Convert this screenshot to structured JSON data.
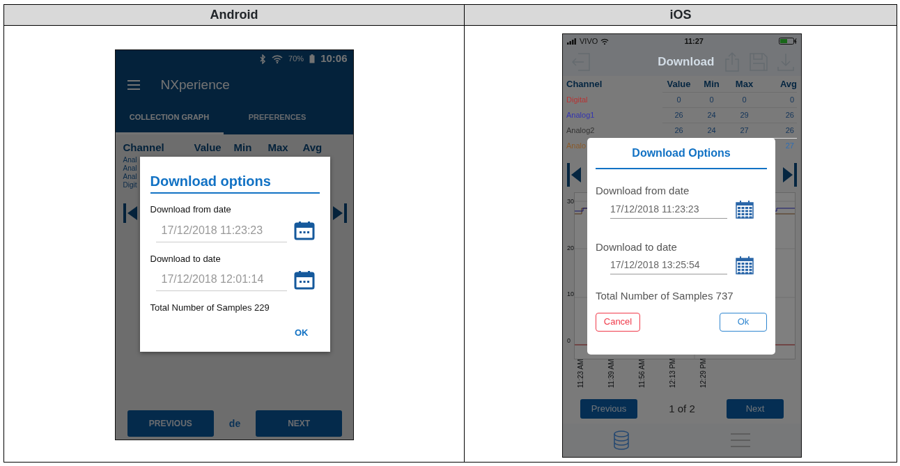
{
  "table": {
    "columns": [
      "Android",
      "iOS"
    ]
  },
  "android": {
    "status": {
      "battery": "70%",
      "time": "10:06"
    },
    "app_title": "NXperience",
    "tabs": [
      {
        "label": "COLLECTION GRAPH",
        "selected": true
      },
      {
        "label": "PREFERENCES",
        "selected": false
      }
    ],
    "columns": [
      "Channel",
      "Value",
      "Min",
      "Max",
      "Avg"
    ],
    "channels": [
      "Anal",
      "Anal",
      "Anal",
      "Digit"
    ],
    "bottom": {
      "previous": "PREVIOUS",
      "page": "de",
      "next": "NEXT"
    },
    "dialog": {
      "title": "Download options",
      "fields": [
        {
          "label": "Download from date",
          "value": "17/12/2018 11:23:23"
        },
        {
          "label": "Download to date",
          "value": "17/12/2018 12:01:14"
        }
      ],
      "total": "Total Number of Samples  229",
      "buttons": [
        {
          "label": "OK",
          "kind": "text"
        }
      ]
    }
  },
  "ios": {
    "status": {
      "carrier": "VIVO",
      "time": "11:27"
    },
    "toolbar_title": "Download",
    "columns": [
      "Channel",
      "Value",
      "Min",
      "Max",
      "Avg"
    ],
    "rows": [
      {
        "channel": "Digital",
        "color": "#b83232",
        "values": [
          "0",
          "0",
          "0",
          "0"
        ]
      },
      {
        "channel": "Analog1",
        "color": "#3434b0",
        "values": [
          "26",
          "24",
          "29",
          "26"
        ]
      },
      {
        "channel": "Analog2",
        "color": "#333333",
        "values": [
          "26",
          "24",
          "27",
          "26"
        ]
      },
      {
        "channel": "Analo",
        "color": "#8a5a2a",
        "values": [
          "27"
        ]
      }
    ],
    "graph": {
      "y_labels": [
        "30",
        "20",
        "10",
        "0"
      ],
      "x_labels": [
        "11:23 AM",
        "11:39 AM",
        "11:56 AM",
        "12:13 PM",
        "12:29 PM"
      ]
    },
    "bottom": {
      "previous": "Previous",
      "page": "1 of 2",
      "next": "Next"
    },
    "dialog": {
      "title": "Download Options",
      "fields": [
        {
          "label": "Download from date",
          "value": "17/12/2018 11:23:23"
        },
        {
          "label": "Download to date",
          "value": "17/12/2018 13:25:54"
        }
      ],
      "total": "Total Number of Samples 737",
      "buttons": [
        {
          "label": "Cancel",
          "kind": "danger"
        },
        {
          "label": "Ok",
          "kind": "primary"
        }
      ]
    }
  }
}
